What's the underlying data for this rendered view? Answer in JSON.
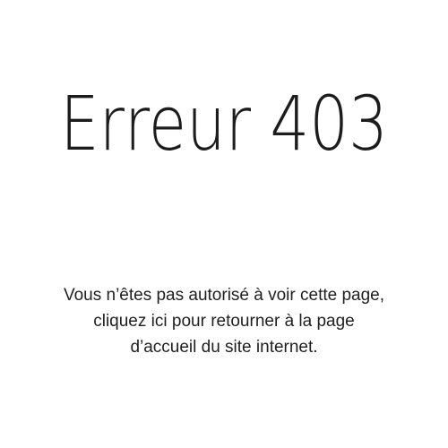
{
  "error": {
    "title_word": "Erreur",
    "title_code": "403"
  },
  "message": {
    "line1": "Vous n’êtes pas autorisé à voir cette page,",
    "line2_link": "cliquez ici",
    "line2_rest": " pour retourner à la page",
    "line3": "d’accueil du site internet."
  }
}
